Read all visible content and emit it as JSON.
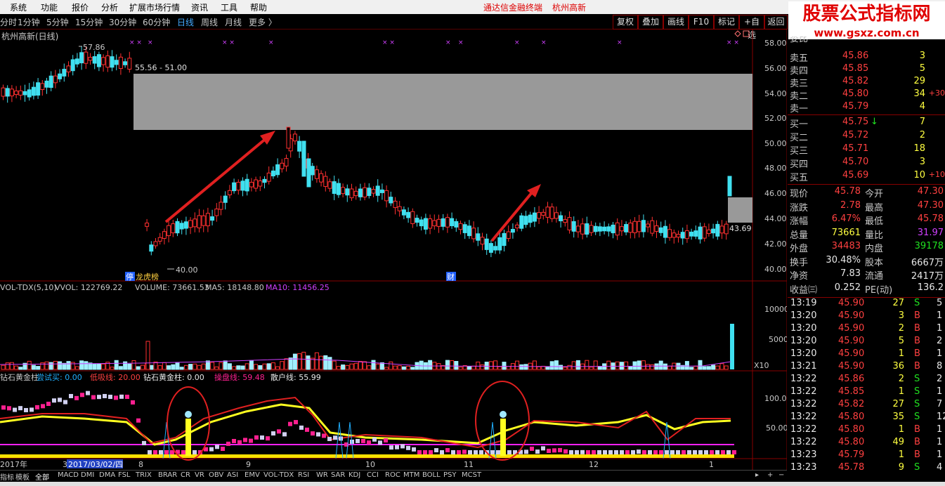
{
  "menu": [
    "系统",
    "功能",
    "报价",
    "分析",
    "扩展市场行情",
    "资讯",
    "工具",
    "帮助"
  ],
  "menu_center": [
    "通达信金融终端",
    "杭州高新"
  ],
  "periods": [
    "分时",
    "1分钟",
    "5分钟",
    "15分钟",
    "30分钟",
    "60分钟",
    "日线",
    "周线",
    "月线",
    "更多 〉"
  ],
  "right_buttons": [
    "复权",
    "叠加",
    "画线",
    "F10",
    "标记",
    "+自选",
    "返回"
  ],
  "watermark": {
    "line1": "股票公式指标网",
    "line2": "www.gsxz.com.cn"
  },
  "chart": {
    "title": "杭州高新(日线)",
    "high_label": "57.86",
    "range_label": "55.56 - 51.00",
    "low_label": "40.00",
    "last_label": "43.69",
    "tags": [
      "停",
      "龙虎榜",
      "财"
    ],
    "price_axis": [
      "58.00",
      "56.00",
      "54.00",
      "52.00",
      "50.00",
      "48.00",
      "46.00",
      "44.00",
      "42.00",
      "40.00"
    ],
    "vol_header": {
      "name": "VOL-TDX(5,10)",
      "vvol": "VVOL: 122769.22",
      "volume": "VOLUME: 73661.53",
      "ma5": "MA5: 18148.80",
      "ma10": "MA10: 11456.25"
    },
    "vol_axis": [
      "10000",
      "5000"
    ],
    "vol_unit": "X10",
    "ind_header": {
      "name": "钻石黄金柱",
      "l1": "尝试买: 0.00",
      "l2": "低吸线: 20.00",
      "l3": "钻石黄金柱: 0.00",
      "l4": "操盘线: 59.48",
      "l5": "散户线: 55.99"
    },
    "ind_axis": [
      "100.0",
      "50.00"
    ],
    "date_axis": [
      "2017年",
      "3",
      "2017/03/02/四",
      "8",
      "9",
      "10",
      "11",
      "12",
      "1"
    ],
    "bottom_tabs": [
      "指标",
      "模板",
      "全部",
      "MACD",
      "DMI",
      "DMA",
      "FSL",
      "TRIX",
      "BRAR",
      "CR",
      "VR",
      "OBV",
      "ASI",
      "EMV",
      "VOL-TDX",
      "RSI",
      "WR",
      "SAR",
      "KDJ",
      "CCI",
      "ROC",
      "MTM",
      "BOLL",
      "PSY",
      "MCST"
    ]
  },
  "quote": {
    "partial_top": "委比",
    "asks": [
      {
        "label": "卖五",
        "price": "45.86",
        "vol": "3"
      },
      {
        "label": "卖四",
        "price": "45.85",
        "vol": "5"
      },
      {
        "label": "卖三",
        "price": "45.82",
        "vol": "29"
      },
      {
        "label": "卖二",
        "price": "45.80",
        "vol": "34",
        "chg": "+30"
      },
      {
        "label": "卖一",
        "price": "45.79",
        "vol": "4"
      }
    ],
    "bids": [
      {
        "label": "买一",
        "price": "45.75",
        "vol": "7",
        "arrow": "↓"
      },
      {
        "label": "买二",
        "price": "45.72",
        "vol": "2"
      },
      {
        "label": "买三",
        "price": "45.71",
        "vol": "18"
      },
      {
        "label": "买四",
        "price": "45.70",
        "vol": "3"
      },
      {
        "label": "买五",
        "price": "45.69",
        "vol": "10",
        "chg": "+10"
      }
    ],
    "stats": [
      {
        "l1": "现价",
        "v1": "45.78",
        "l2": "今开",
        "v2": "47.30"
      },
      {
        "l1": "涨跌",
        "v1": "2.78",
        "l2": "最高",
        "v2": "47.30"
      },
      {
        "l1": "涨幅",
        "v1": "6.47%",
        "l2": "最低",
        "v2": "45.78"
      },
      {
        "l1": "总量",
        "v1": "73661",
        "l2": "量比",
        "v2": "31.97"
      },
      {
        "l1": "外盘",
        "v1": "34483",
        "l2": "内盘",
        "v2": "39178"
      },
      {
        "l1": "换手",
        "v1": "30.48%",
        "l2": "股本",
        "v2": "6667万"
      },
      {
        "l1": "净资",
        "v1": "7.83",
        "l2": "流通",
        "v2": "2417万"
      },
      {
        "l1": "收益㈢",
        "v1": "0.252",
        "l2": "PE(动)",
        "v2": "136.2"
      }
    ],
    "ticks": [
      {
        "t": "13:19",
        "p": "45.90",
        "v": "27",
        "s": "S",
        "n": "5"
      },
      {
        "t": "13:20",
        "p": "45.90",
        "v": "3",
        "s": "B",
        "n": "1"
      },
      {
        "t": "13:20",
        "p": "45.90",
        "v": "2",
        "s": "B",
        "n": "1"
      },
      {
        "t": "13:20",
        "p": "45.90",
        "v": "5",
        "s": "B",
        "n": "2"
      },
      {
        "t": "13:20",
        "p": "45.90",
        "v": "1",
        "s": "B",
        "n": "1"
      },
      {
        "t": "13:21",
        "p": "45.90",
        "v": "36",
        "s": "B",
        "n": "8"
      },
      {
        "t": "13:22",
        "p": "45.86",
        "v": "2",
        "s": "S",
        "n": "2"
      },
      {
        "t": "13:22",
        "p": "45.85",
        "v": "1",
        "s": "S",
        "n": "1"
      },
      {
        "t": "13:22",
        "p": "45.82",
        "v": "27",
        "s": "S",
        "n": "7"
      },
      {
        "t": "13:22",
        "p": "45.80",
        "v": "35",
        "s": "S",
        "n": "12"
      },
      {
        "t": "13:22",
        "p": "45.80",
        "v": "1",
        "s": "B",
        "n": "1"
      },
      {
        "t": "13:22",
        "p": "45.80",
        "v": "49",
        "s": "B",
        "n": "1"
      },
      {
        "t": "13:23",
        "p": "45.79",
        "v": "1",
        "s": "B",
        "n": "1"
      },
      {
        "t": "13:23",
        "p": "45.78",
        "v": "9",
        "s": "S",
        "n": "4"
      }
    ]
  }
}
